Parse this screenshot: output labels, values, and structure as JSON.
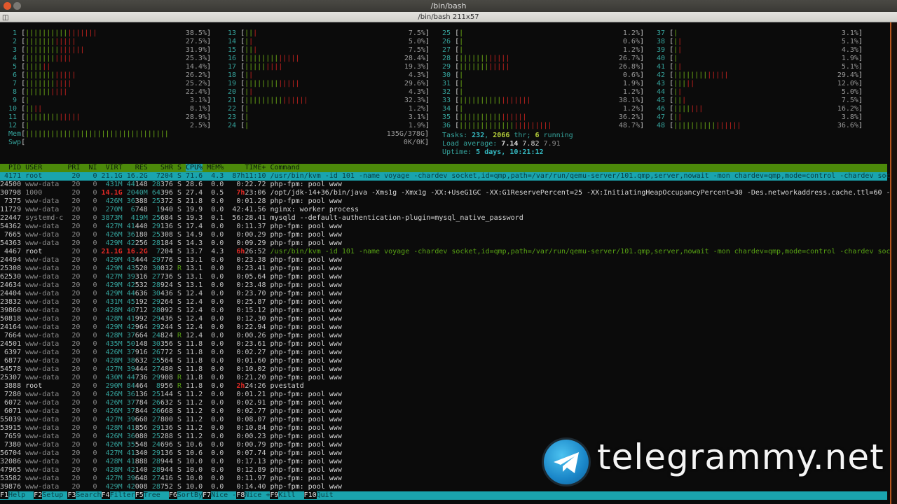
{
  "window": {
    "title": "/bin/bash",
    "tab_title": "/bin/bash 211x57"
  },
  "colors": {
    "bar_green": "#6fae16",
    "bar_red": "#c8221e",
    "teal": "#35a39c",
    "header_bg": "#4c8a0a",
    "selected_bg": "#1aa4ae"
  },
  "meters": {
    "cpus": [
      {
        "id": "1",
        "percent": 38.5
      },
      {
        "id": "2",
        "percent": 27.5
      },
      {
        "id": "3",
        "percent": 31.9
      },
      {
        "id": "4",
        "percent": 25.3
      },
      {
        "id": "5",
        "percent": 14.4
      },
      {
        "id": "6",
        "percent": 26.2
      },
      {
        "id": "7",
        "percent": 25.2
      },
      {
        "id": "8",
        "percent": 22.4
      },
      {
        "id": "9",
        "percent": 3.1
      },
      {
        "id": "10",
        "percent": 8.1
      },
      {
        "id": "11",
        "percent": 28.9
      },
      {
        "id": "12",
        "percent": 2.5
      },
      {
        "id": "13",
        "percent": 7.5
      },
      {
        "id": "14",
        "percent": 5.0
      },
      {
        "id": "15",
        "percent": 7.5
      },
      {
        "id": "16",
        "percent": 28.4
      },
      {
        "id": "17",
        "percent": 19.3
      },
      {
        "id": "18",
        "percent": 4.3
      },
      {
        "id": "19",
        "percent": 29.6
      },
      {
        "id": "20",
        "percent": 4.3
      },
      {
        "id": "21",
        "percent": 32.3
      },
      {
        "id": "22",
        "percent": 1.2
      },
      {
        "id": "23",
        "percent": 3.1
      },
      {
        "id": "24",
        "percent": 1.9
      },
      {
        "id": "25",
        "percent": 1.2
      },
      {
        "id": "26",
        "percent": 0.6
      },
      {
        "id": "27",
        "percent": 1.2
      },
      {
        "id": "28",
        "percent": 26.7
      },
      {
        "id": "29",
        "percent": 26.8
      },
      {
        "id": "30",
        "percent": 0.6
      },
      {
        "id": "31",
        "percent": 1.9
      },
      {
        "id": "32",
        "percent": 1.2
      },
      {
        "id": "33",
        "percent": 38.1
      },
      {
        "id": "34",
        "percent": 1.2
      },
      {
        "id": "35",
        "percent": 36.2
      },
      {
        "id": "36",
        "percent": 48.7
      },
      {
        "id": "37",
        "percent": 3.1
      },
      {
        "id": "38",
        "percent": 5.1
      },
      {
        "id": "39",
        "percent": 4.3
      },
      {
        "id": "40",
        "percent": 1.9
      },
      {
        "id": "41",
        "percent": 5.1
      },
      {
        "id": "42",
        "percent": 29.4
      },
      {
        "id": "43",
        "percent": 12.0
      },
      {
        "id": "44",
        "percent": 5.0
      },
      {
        "id": "45",
        "percent": 7.5
      },
      {
        "id": "46",
        "percent": 16.2
      },
      {
        "id": "47",
        "percent": 3.8
      },
      {
        "id": "48",
        "percent": 36.6
      }
    ],
    "mem": {
      "label": "Mem",
      "used": "135G",
      "total": "378G",
      "fraction": 0.357
    },
    "swp": {
      "label": "Swp",
      "used": "0K",
      "total": "0K",
      "fraction": 0
    }
  },
  "summary": {
    "tasks_label": "Tasks: ",
    "tasks": "232",
    "threads": "2066",
    "thr_label": " thr; ",
    "running": "6",
    "running_label": " running",
    "load_label": "Load average: ",
    "load1": "7.14",
    "load5": "7.82",
    "load15": "7.91",
    "uptime_label": "Uptime: ",
    "uptime": "5 days, 10:21:12"
  },
  "table": {
    "columns": [
      "PID",
      "USER",
      "PRI",
      "NI",
      "VIRT",
      "RES",
      "SHR",
      "S",
      "CPU%",
      "MEM%",
      "TIME+",
      "Command"
    ],
    "sort_column": "CPU%",
    "selected_index": 0,
    "rows": [
      [
        "4171",
        "root",
        "20",
        "0",
        "21.1G",
        "16.2G",
        "7204",
        "S",
        "71.6",
        "4.3",
        "87h11:10",
        "/usr/bin/kvm -id 101 -name voyage -chardev socket,id=qmp,path=/var/run/qemu-server/101.qmp,server,nowait -mon chardev=qmp,mode=control -chardev sock"
      ],
      [
        "24500",
        "www-data",
        "20",
        "0",
        "431M",
        "44148",
        "28376",
        "S",
        "28.6",
        "0.0",
        "0:22.72",
        "php-fpm: pool www"
      ],
      [
        "30798",
        "1000",
        "20",
        "0",
        "14.1G",
        "2040M",
        "64396",
        "S",
        "27.4",
        "0.5",
        "7h23:06",
        "/opt/jdk-14+36/bin/java -Xms1g -Xmx1g -XX:+UseG1GC -XX:G1ReservePercent=25 -XX:InitiatingHeapOccupancyPercent=30 -Des.networkaddress.cache.ttl=60 -D"
      ],
      [
        "7375",
        "www-data",
        "20",
        "0",
        "426M",
        "36388",
        "25372",
        "S",
        "21.8",
        "0.0",
        "0:01.28",
        "php-fpm: pool www"
      ],
      [
        "11729",
        "www-data",
        "20",
        "0",
        "270M",
        "6748",
        "1940",
        "S",
        "19.9",
        "0.0",
        "42:41.56",
        "nginx: worker process"
      ],
      [
        "22447",
        "systemd-c",
        "20",
        "0",
        "3873M",
        "419M",
        "25684",
        "S",
        "19.3",
        "0.1",
        "56:28.41",
        "mysqld --default-authentication-plugin=mysql_native_password"
      ],
      [
        "54362",
        "www-data",
        "20",
        "0",
        "427M",
        "41440",
        "29136",
        "S",
        "17.4",
        "0.0",
        "0:11.37",
        "php-fpm: pool www"
      ],
      [
        "7665",
        "www-data",
        "20",
        "0",
        "426M",
        "36180",
        "25308",
        "S",
        "14.9",
        "0.0",
        "0:00.29",
        "php-fpm: pool www"
      ],
      [
        "54363",
        "www-data",
        "20",
        "0",
        "429M",
        "42256",
        "28184",
        "S",
        "14.3",
        "0.0",
        "0:09.29",
        "php-fpm: pool www"
      ],
      [
        "4467",
        "root",
        "20",
        "0",
        "21.1G",
        "16.2G",
        "7204",
        "S",
        "13.7",
        "4.3",
        "6h26:52",
        "/usr/bin/kvm -id 101 -name voyage -chardev socket,id=qmp,path=/var/run/qemu-server/101.qmp,server,nowait -mon chardev=qmp,mode=control -chardev sock"
      ],
      [
        "24494",
        "www-data",
        "20",
        "0",
        "429M",
        "43444",
        "29776",
        "S",
        "13.1",
        "0.0",
        "0:23.38",
        "php-fpm: pool www"
      ],
      [
        "25308",
        "www-data",
        "20",
        "0",
        "429M",
        "43520",
        "30032",
        "R",
        "13.1",
        "0.0",
        "0:23.41",
        "php-fpm: pool www"
      ],
      [
        "62530",
        "www-data",
        "20",
        "0",
        "427M",
        "39316",
        "27736",
        "S",
        "13.1",
        "0.0",
        "0:05.64",
        "php-fpm: pool www"
      ],
      [
        "24634",
        "www-data",
        "20",
        "0",
        "429M",
        "42532",
        "28924",
        "S",
        "13.1",
        "0.0",
        "0:23.48",
        "php-fpm: pool www"
      ],
      [
        "24404",
        "www-data",
        "20",
        "0",
        "429M",
        "44636",
        "30436",
        "S",
        "12.4",
        "0.0",
        "0:23.70",
        "php-fpm: pool www"
      ],
      [
        "23832",
        "www-data",
        "20",
        "0",
        "431M",
        "45192",
        "29264",
        "S",
        "12.4",
        "0.0",
        "0:25.87",
        "php-fpm: pool www"
      ],
      [
        "39860",
        "www-data",
        "20",
        "0",
        "428M",
        "40712",
        "28092",
        "S",
        "12.4",
        "0.0",
        "0:15.12",
        "php-fpm: pool www"
      ],
      [
        "50818",
        "www-data",
        "20",
        "0",
        "428M",
        "41992",
        "29436",
        "S",
        "12.4",
        "0.0",
        "0:12.30",
        "php-fpm: pool www"
      ],
      [
        "24164",
        "www-data",
        "20",
        "0",
        "429M",
        "42964",
        "29244",
        "S",
        "12.4",
        "0.0",
        "0:22.94",
        "php-fpm: pool www"
      ],
      [
        "7664",
        "www-data",
        "20",
        "0",
        "428M",
        "37664",
        "24824",
        "R",
        "12.4",
        "0.0",
        "0:00.26",
        "php-fpm: pool www"
      ],
      [
        "24501",
        "www-data",
        "20",
        "0",
        "435M",
        "50148",
        "30356",
        "S",
        "11.8",
        "0.0",
        "0:23.61",
        "php-fpm: pool www"
      ],
      [
        "6397",
        "www-data",
        "20",
        "0",
        "426M",
        "37916",
        "26772",
        "S",
        "11.8",
        "0.0",
        "0:02.27",
        "php-fpm: pool www"
      ],
      [
        "6877",
        "www-data",
        "20",
        "0",
        "428M",
        "38632",
        "25564",
        "S",
        "11.8",
        "0.0",
        "0:01.60",
        "php-fpm: pool www"
      ],
      [
        "54578",
        "www-data",
        "20",
        "0",
        "427M",
        "39444",
        "27480",
        "S",
        "11.8",
        "0.0",
        "0:10.02",
        "php-fpm: pool www"
      ],
      [
        "25307",
        "www-data",
        "20",
        "0",
        "430M",
        "44736",
        "29908",
        "R",
        "11.8",
        "0.0",
        "0:21.20",
        "php-fpm: pool www"
      ],
      [
        "3888",
        "root",
        "20",
        "0",
        "290M",
        "84464",
        "8956",
        "R",
        "11.8",
        "0.0",
        "2h24:26",
        "pvestatd"
      ],
      [
        "7280",
        "www-data",
        "20",
        "0",
        "426M",
        "36136",
        "25144",
        "S",
        "11.2",
        "0.0",
        "0:01.21",
        "php-fpm: pool www"
      ],
      [
        "6072",
        "www-data",
        "20",
        "0",
        "426M",
        "37784",
        "26632",
        "S",
        "11.2",
        "0.0",
        "0:02.91",
        "php-fpm: pool www"
      ],
      [
        "6071",
        "www-data",
        "20",
        "0",
        "426M",
        "37844",
        "26668",
        "S",
        "11.2",
        "0.0",
        "0:02.77",
        "php-fpm: pool www"
      ],
      [
        "55039",
        "www-data",
        "20",
        "0",
        "427M",
        "39660",
        "27800",
        "S",
        "11.2",
        "0.0",
        "0:08.07",
        "php-fpm: pool www"
      ],
      [
        "53915",
        "www-data",
        "20",
        "0",
        "428M",
        "41856",
        "29136",
        "S",
        "11.2",
        "0.0",
        "0:10.84",
        "php-fpm: pool www"
      ],
      [
        "7659",
        "www-data",
        "20",
        "0",
        "426M",
        "36080",
        "25288",
        "S",
        "11.2",
        "0.0",
        "0:00.23",
        "php-fpm: pool www"
      ],
      [
        "7380",
        "www-data",
        "20",
        "0",
        "426M",
        "35548",
        "24696",
        "S",
        "10.6",
        "0.0",
        "0:00.79",
        "php-fpm: pool www"
      ],
      [
        "56704",
        "www-data",
        "20",
        "0",
        "427M",
        "41340",
        "29136",
        "S",
        "10.6",
        "0.0",
        "0:07.74",
        "php-fpm: pool www"
      ],
      [
        "32086",
        "www-data",
        "20",
        "0",
        "428M",
        "41888",
        "28944",
        "S",
        "10.0",
        "0.0",
        "0:17.13",
        "php-fpm: pool www"
      ],
      [
        "47965",
        "www-data",
        "20",
        "0",
        "428M",
        "42140",
        "28944",
        "S",
        "10.0",
        "0.0",
        "0:12.89",
        "php-fpm: pool www"
      ],
      [
        "53582",
        "www-data",
        "20",
        "0",
        "427M",
        "39648",
        "27416",
        "S",
        "10.0",
        "0.0",
        "0:11.97",
        "php-fpm: pool www"
      ],
      [
        "39876",
        "www-data",
        "20",
        "0",
        "429M",
        "42008",
        "28752",
        "S",
        "10.0",
        "0.0",
        "0:14.40",
        "php-fpm: pool www"
      ]
    ]
  },
  "footer": [
    {
      "key": "F1",
      "label": "Help  "
    },
    {
      "key": "F2",
      "label": "Setup "
    },
    {
      "key": "F3",
      "label": "Search"
    },
    {
      "key": "F4",
      "label": "Filter"
    },
    {
      "key": "F5",
      "label": "Tree  "
    },
    {
      "key": "F6",
      "label": "SortBy"
    },
    {
      "key": "F7",
      "label": "Nice -"
    },
    {
      "key": "F8",
      "label": "Nice +"
    },
    {
      "key": "F9",
      "label": "Kill  "
    },
    {
      "key": "F10",
      "label": "Quit"
    }
  ],
  "watermark": {
    "text": "telegrammy.net",
    "icon": "telegram-paper-plane-icon"
  }
}
